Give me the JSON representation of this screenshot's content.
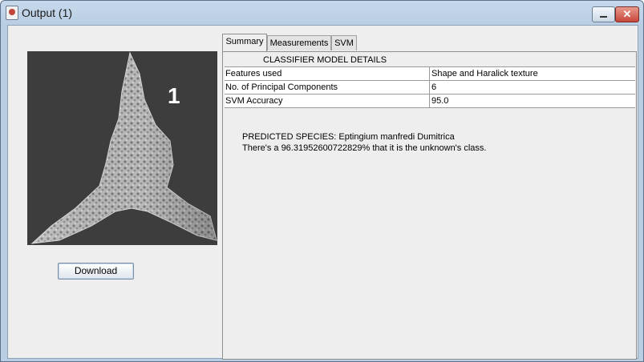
{
  "window": {
    "title": "Output (1)"
  },
  "left": {
    "specimen_label": "1",
    "download_label": "Download"
  },
  "tabs": [
    {
      "label": "Summary"
    },
    {
      "label": "Measurements"
    },
    {
      "label": "SVM"
    }
  ],
  "summary": {
    "table_header": "CLASSIFIER MODEL DETAILS",
    "rows": [
      {
        "key": "Features used",
        "value": "Shape and Haralick texture"
      },
      {
        "key": "No. of Principal Components",
        "value": "6"
      },
      {
        "key": "SVM Accuracy",
        "value": "95.0"
      }
    ],
    "prediction_line": "PREDICTED SPECIES: Eptingium manfredi Dumitrica",
    "probability_line": "There's a 96.31952600722829% that it is the unknown's class."
  }
}
